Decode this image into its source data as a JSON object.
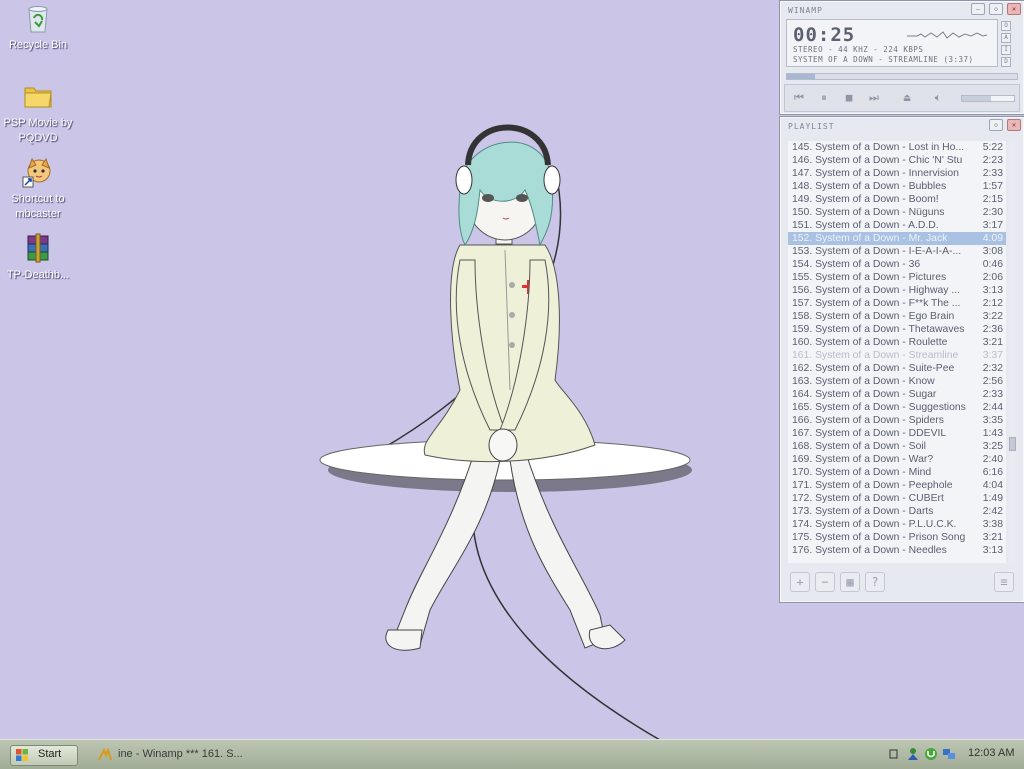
{
  "desktop": {
    "icons": [
      {
        "label": "Recycle Bin",
        "icon": "recycle-bin-icon"
      },
      {
        "label": "PSP Movie by PQDVD",
        "icon": "folder-icon"
      },
      {
        "label": "Shortcut to mbcaster",
        "icon": "mbcaster-shortcut-icon"
      },
      {
        "label": "TP-Deathb...",
        "icon": "winrar-archive-icon"
      }
    ]
  },
  "winamp": {
    "title": "WINAMP",
    "time": "00:25",
    "info_line": "STEREO - 44 KHZ - 224 KBPS",
    "track_line": "SYSTEM OF A DOWN - STREAMLINE (3:37)",
    "seek_fraction": 0.12,
    "volume_fraction": 0.55,
    "controls": [
      "previous-icon",
      "pause-icon",
      "stop-icon",
      "next-icon",
      "eject-icon",
      "volume-icon"
    ]
  },
  "playlist": {
    "title": "PLAYLIST",
    "items": [
      {
        "title": "145. System of a Down - Lost in Ho...",
        "duration": "5:22",
        "state": ""
      },
      {
        "title": "146. System of a Down - Chic 'N' Stu",
        "duration": "2:23",
        "state": ""
      },
      {
        "title": "147. System of a Down - Innervision",
        "duration": "2:33",
        "state": ""
      },
      {
        "title": "148. System of a Down - Bubbles",
        "duration": "1:57",
        "state": ""
      },
      {
        "title": "149. System of a Down - Boom!",
        "duration": "2:15",
        "state": ""
      },
      {
        "title": "150. System of a Down - Nüguns",
        "duration": "2:30",
        "state": ""
      },
      {
        "title": "151. System of a Down - A.D.D.",
        "duration": "3:17",
        "state": ""
      },
      {
        "title": "152. System of a Down - Mr. Jack",
        "duration": "4:09",
        "state": "selected"
      },
      {
        "title": "153. System of a Down - I-E-A-I-A-...",
        "duration": "3:08",
        "state": ""
      },
      {
        "title": "154. System of a Down - 36",
        "duration": "0:46",
        "state": ""
      },
      {
        "title": "155. System of a Down - Pictures",
        "duration": "2:06",
        "state": ""
      },
      {
        "title": "156. System of a Down - Highway ...",
        "duration": "3:13",
        "state": ""
      },
      {
        "title": "157. System of a Down - F**k The ...",
        "duration": "2:12",
        "state": ""
      },
      {
        "title": "158. System of a Down - Ego Brain",
        "duration": "3:22",
        "state": ""
      },
      {
        "title": "159. System of a Down - Thetawaves",
        "duration": "2:36",
        "state": ""
      },
      {
        "title": "160. System of a Down - Roulette",
        "duration": "3:21",
        "state": ""
      },
      {
        "title": "161. System of a Down - Streamline",
        "duration": "3:37",
        "state": "playing"
      },
      {
        "title": "162. System of a Down - Suite-Pee",
        "duration": "2:32",
        "state": ""
      },
      {
        "title": "163. System of a Down - Know",
        "duration": "2:56",
        "state": ""
      },
      {
        "title": "164. System of a Down - Sugar",
        "duration": "2:33",
        "state": ""
      },
      {
        "title": "165. System of a Down - Suggestions",
        "duration": "2:44",
        "state": ""
      },
      {
        "title": "166. System of a Down - Spiders",
        "duration": "3:35",
        "state": ""
      },
      {
        "title": "167. System of a Down - DDEVIL",
        "duration": "1:43",
        "state": ""
      },
      {
        "title": "168. System of a Down - Soil",
        "duration": "3:25",
        "state": ""
      },
      {
        "title": "169. System of a Down - War?",
        "duration": "2:40",
        "state": ""
      },
      {
        "title": "170. System of a Down - Mind",
        "duration": "6:16",
        "state": ""
      },
      {
        "title": "171. System of a Down - Peephole",
        "duration": "4:04",
        "state": ""
      },
      {
        "title": "172. System of a Down - CUBErt",
        "duration": "1:49",
        "state": ""
      },
      {
        "title": "173. System of a Down - Darts",
        "duration": "2:42",
        "state": ""
      },
      {
        "title": "174. System of a Down - P.L.U.C.K.",
        "duration": "3:38",
        "state": ""
      },
      {
        "title": "175. System of a Down - Prison Song",
        "duration": "3:21",
        "state": ""
      },
      {
        "title": "176. System of a Down - Needles",
        "duration": "3:13",
        "state": ""
      }
    ],
    "bottom_buttons": [
      "add-icon",
      "remove-icon",
      "select-icon",
      "misc-icon",
      "list-options-icon"
    ]
  },
  "taskbar": {
    "start_label": "Start",
    "tasks": [
      {
        "label": "ine - Winamp *** 161. S...",
        "icon": "winamp-icon"
      }
    ],
    "clock": "12:03 AM",
    "tray_icons": [
      "tray-expand-icon",
      "messenger-icon",
      "utorrent-icon",
      "network-icon"
    ]
  },
  "colors": {
    "desktop_bg": "#cbc5e8",
    "selection": "#a9c1e2"
  }
}
